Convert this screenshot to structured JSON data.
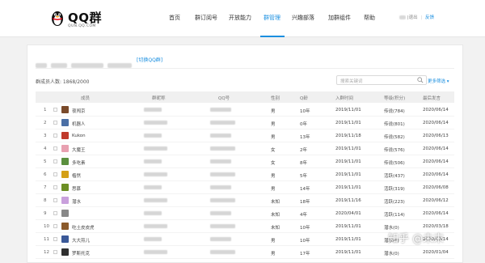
{
  "header": {
    "logo_text": "QQ群",
    "logo_sub": "QUN.QQ.COM",
    "nav": [
      {
        "label": "首页",
        "active": false
      },
      {
        "label": "群订阅号",
        "active": false
      },
      {
        "label": "开放能力",
        "active": false
      },
      {
        "label": "群管理",
        "active": true
      },
      {
        "label": "兴趣部落",
        "active": false
      },
      {
        "label": "加群组件",
        "active": false
      },
      {
        "label": "帮助",
        "active": false
      }
    ],
    "user": {
      "logout": "|退出",
      "feedback": "反馈"
    }
  },
  "group": {
    "switch_label": "[切换QQ群]",
    "member_count": "群成员人数: 1868/2000"
  },
  "search": {
    "placeholder": "搜索关键词"
  },
  "more_filter": "更多筛选 ▾",
  "table": {
    "headers": [
      "成员",
      "群昵称",
      "QQ号",
      "性别",
      "Q龄",
      "入群时间",
      "等级(积分)",
      "最后发言"
    ],
    "rows": [
      {
        "index": "1",
        "name": "夜闯京",
        "gender": "男",
        "age": "10年",
        "joined": "2019/11/01",
        "level": "传说(784)",
        "last": "2020/06/14",
        "avatar_color": "#7a4a2a"
      },
      {
        "index": "2",
        "name": "机器人",
        "gender": "男",
        "age": "0年",
        "joined": "2019/11/01",
        "level": "传说(801)",
        "last": "2020/06/14",
        "avatar_color": "#4a6fa5"
      },
      {
        "index": "3",
        "name": "Kukon",
        "gender": "男",
        "age": "13年",
        "joined": "2019/11/18",
        "level": "传说(582)",
        "last": "2020/06/13",
        "avatar_color": "#c0392b"
      },
      {
        "index": "4",
        "name": "大魔王",
        "gender": "女",
        "age": "2年",
        "joined": "2019/11/01",
        "level": "传说(576)",
        "last": "2020/06/14",
        "avatar_color": "#e8a0b0"
      },
      {
        "index": "5",
        "name": "多吃素",
        "gender": "女",
        "age": "8年",
        "joined": "2019/11/01",
        "level": "传说(506)",
        "last": "2020/06/14",
        "avatar_color": "#5a8f3e"
      },
      {
        "index": "6",
        "name": "楷然",
        "gender": "男",
        "age": "5年",
        "joined": "2019/11/01",
        "level": "活跃(437)",
        "last": "2020/06/14",
        "avatar_color": "#d4a017"
      },
      {
        "index": "7",
        "name": "思慕",
        "gender": "男",
        "age": "14年",
        "joined": "2019/11/01",
        "level": "活跃(319)",
        "last": "2020/06/08",
        "avatar_color": "#6b8e23"
      },
      {
        "index": "8",
        "name": "潜水",
        "gender": "未知",
        "age": "18年",
        "joined": "2019/11/16",
        "level": "活跃(223)",
        "last": "2020/06/12",
        "avatar_color": "#c9a0dc"
      },
      {
        "index": "9",
        "name": "",
        "gender": "未知",
        "age": "4年",
        "joined": "2020/04/01",
        "level": "活跃(114)",
        "last": "2020/06/14",
        "avatar_color": "#888888"
      },
      {
        "index": "10",
        "name": "吃土皮皮虎",
        "gender": "未知",
        "age": "10年",
        "joined": "2019/11/01",
        "level": "潜水(0)",
        "last": "2020/03/18",
        "avatar_color": "#8b5a2b"
      },
      {
        "index": "11",
        "name": "大大煎儿",
        "gender": "男",
        "age": "10年",
        "joined": "2019/11/01",
        "level": "潜水(0)",
        "last": "2020/06/14",
        "avatar_color": "#3b5998"
      },
      {
        "index": "12",
        "name": "罗斯托克",
        "gender": "男",
        "age": "17年",
        "joined": "2019/11/01",
        "level": "潜水(0)",
        "last": "2020/01/04",
        "avatar_color": "#2f2f2f"
      }
    ]
  },
  "watermark": "知乎 @未末"
}
